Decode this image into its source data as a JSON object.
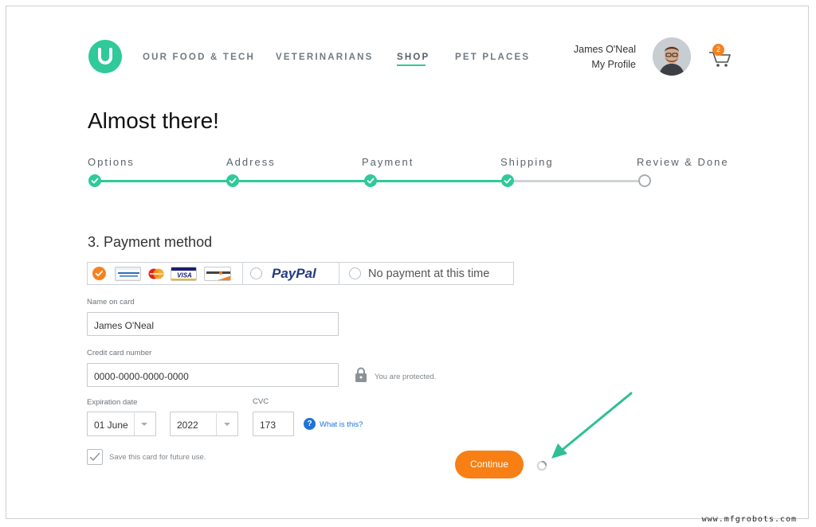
{
  "nav": {
    "items": [
      {
        "label": "OUR FOOD & TECH",
        "active": false
      },
      {
        "label": "VETERINARIANS",
        "active": false
      },
      {
        "label": "SHOP",
        "active": true
      },
      {
        "label": "PET PLACES",
        "active": false
      }
    ],
    "accent_color": "#2fc99a"
  },
  "user": {
    "name": "James O'Neal",
    "profile_link": "My Profile",
    "avatar": "user-avatar"
  },
  "cart": {
    "icon": "cart-icon",
    "count": "2",
    "badge_color": "#f5821f"
  },
  "page": {
    "title": "Almost there!"
  },
  "steps": [
    {
      "label": "Options",
      "status": "done"
    },
    {
      "label": "Address",
      "status": "done"
    },
    {
      "label": "Payment",
      "status": "done"
    },
    {
      "label": "Shipping",
      "status": "done"
    },
    {
      "label": "Review & Done",
      "status": "todo"
    }
  ],
  "payment": {
    "section_title": "3. Payment method",
    "methods": [
      {
        "id": "cards",
        "selected": true,
        "cards": [
          "AMERICAN EXPRESS",
          "mastercard",
          "VISA",
          "DISCOVER"
        ]
      },
      {
        "id": "paypal",
        "label": "PayPal",
        "selected": false
      },
      {
        "id": "none",
        "label": "No payment at this time",
        "selected": false
      }
    ]
  },
  "form": {
    "name_label": "Name on card",
    "name_value": "James O'Neal",
    "card_label": "Credit card number",
    "card_value": "0000-0000-0000-0000",
    "protected_text": "You are protected.",
    "expiry_label": "Expiration date",
    "expiry_month": "01 June",
    "expiry_year": "2022",
    "cvc_label": "CVC",
    "cvc_value": "173",
    "help_icon": "?",
    "help_text": "What is this?",
    "save_card_label": "Save this card for future use.",
    "save_card_checked": true
  },
  "actions": {
    "continue_label": "Continue",
    "continue_color": "#f77f13"
  },
  "watermark": "www.mfgrobots.com"
}
